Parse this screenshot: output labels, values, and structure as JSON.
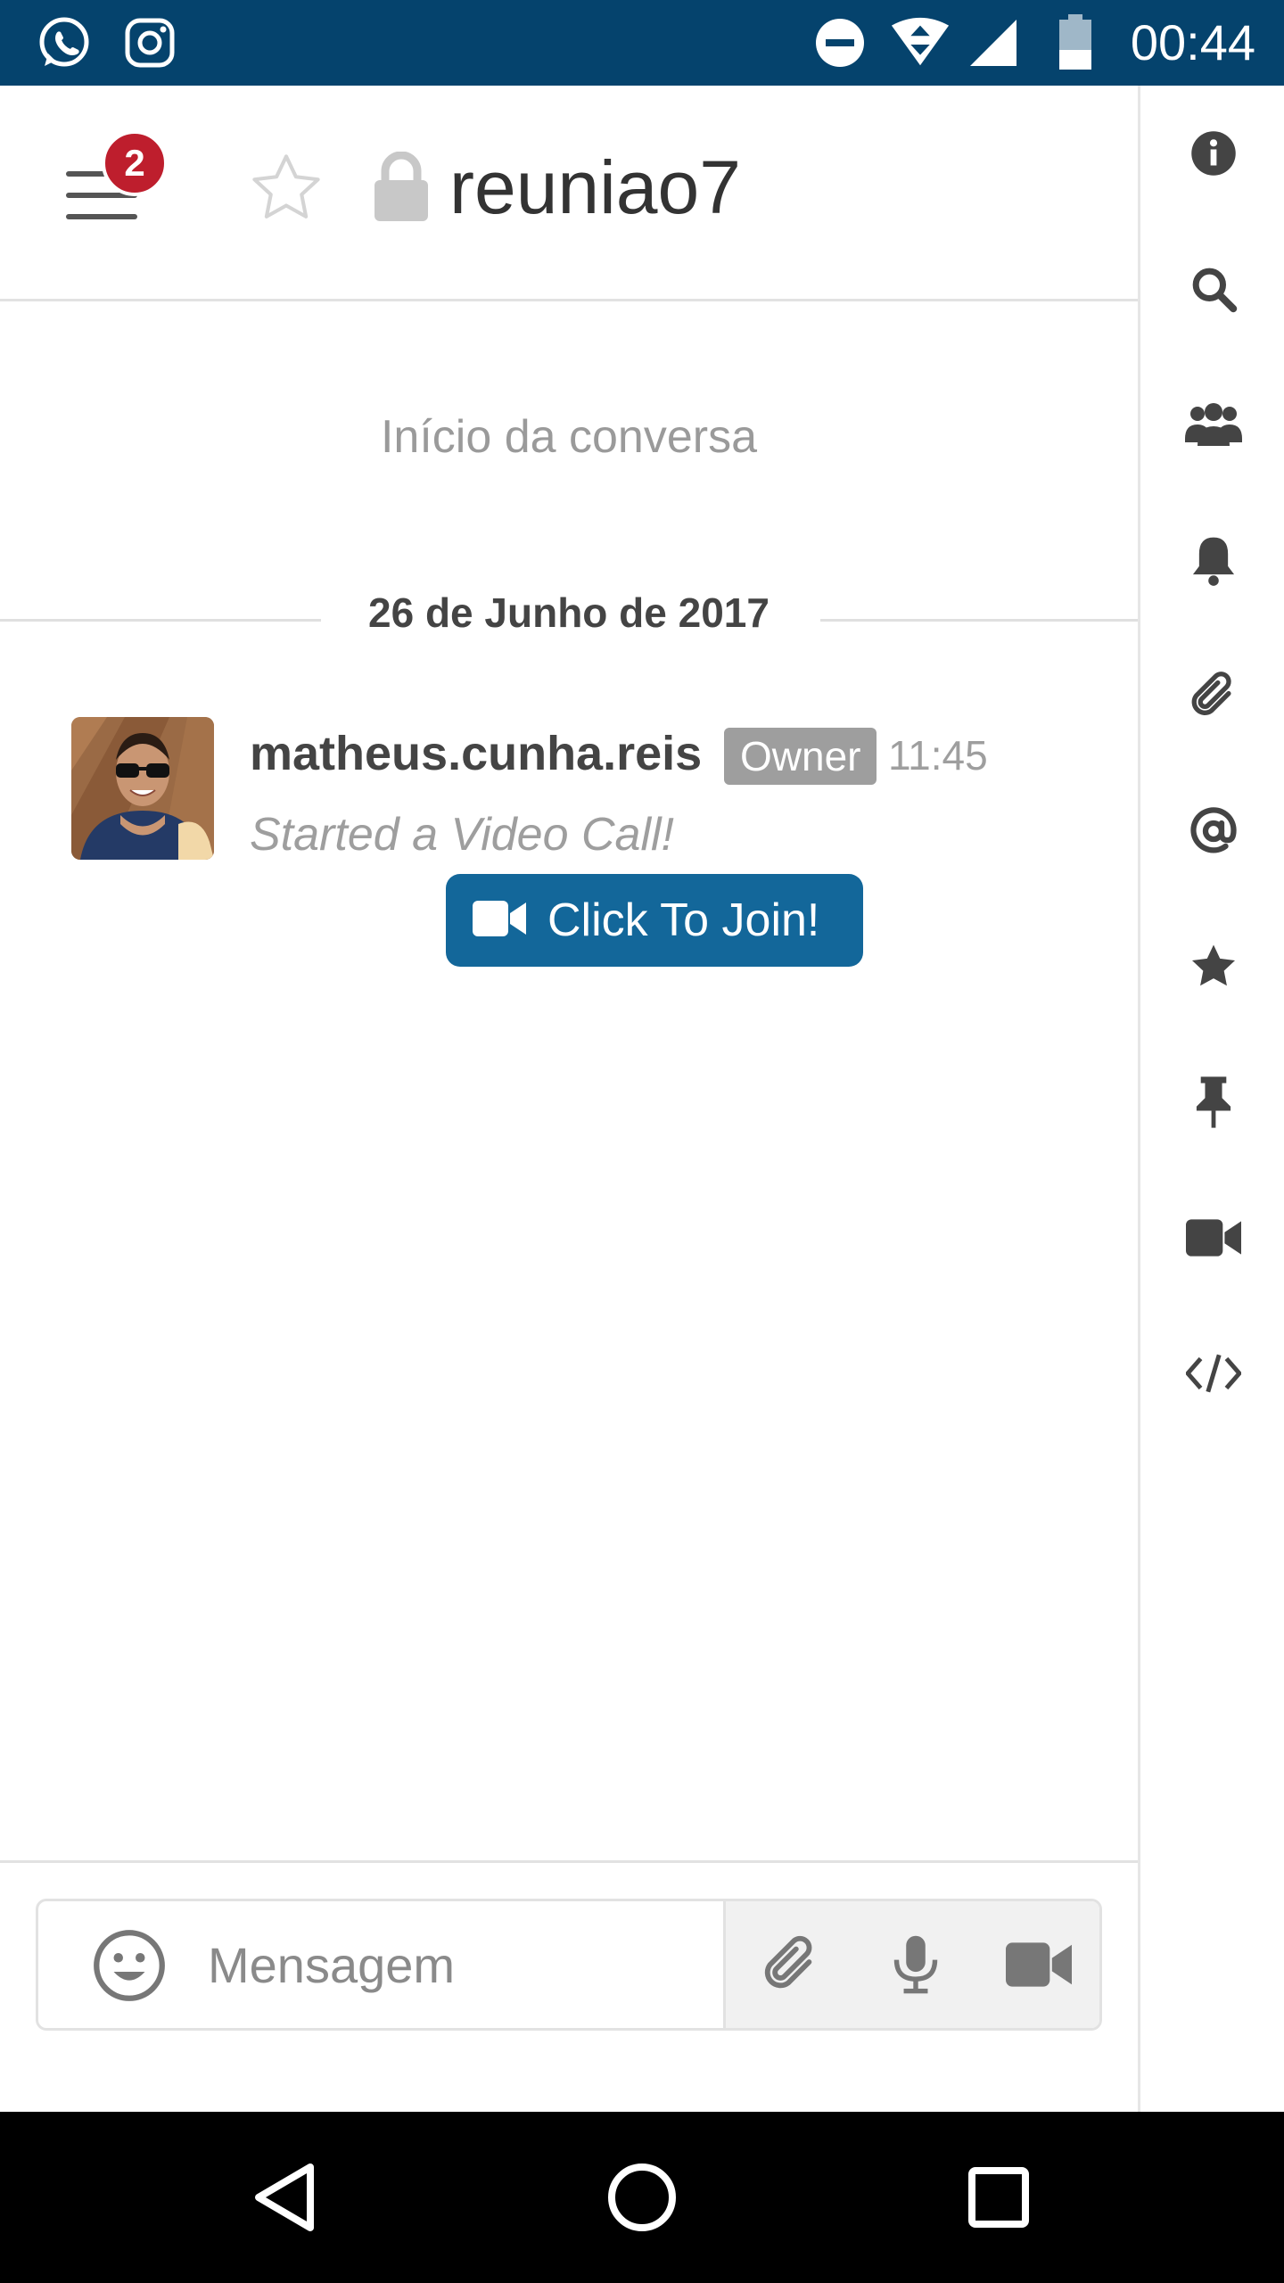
{
  "status_bar": {
    "time": "00:44",
    "battery_level": "35",
    "left_icons": [
      "whatsapp-icon",
      "instagram-icon"
    ],
    "right_icons": [
      "do-not-disturb-icon",
      "wifi-icon",
      "signal-icon",
      "battery-icon"
    ]
  },
  "header": {
    "unread_badge": "2",
    "room_title": "reuniao7"
  },
  "toolbar": {
    "items": [
      "info-icon",
      "search-icon",
      "members-icon",
      "notifications-icon",
      "files-icon",
      "mentions-icon",
      "starred-icon",
      "pinned-icon",
      "video-call-icon",
      "embed-code-icon"
    ]
  },
  "conversation": {
    "start_text": "Início da conversa",
    "date_divider": "26 de Junho de 2017"
  },
  "message": {
    "username": "matheus.cunha.reis",
    "role": "Owner",
    "time": "11:45",
    "text": "Started a Video Call!",
    "join_label": "Click To Join!"
  },
  "composer": {
    "placeholder": "Mensagem"
  },
  "colors": {
    "status_bar": "#05436d",
    "badge": "#be1e2d",
    "join_button": "#13679a",
    "role_badge": "#9e9e9e"
  }
}
